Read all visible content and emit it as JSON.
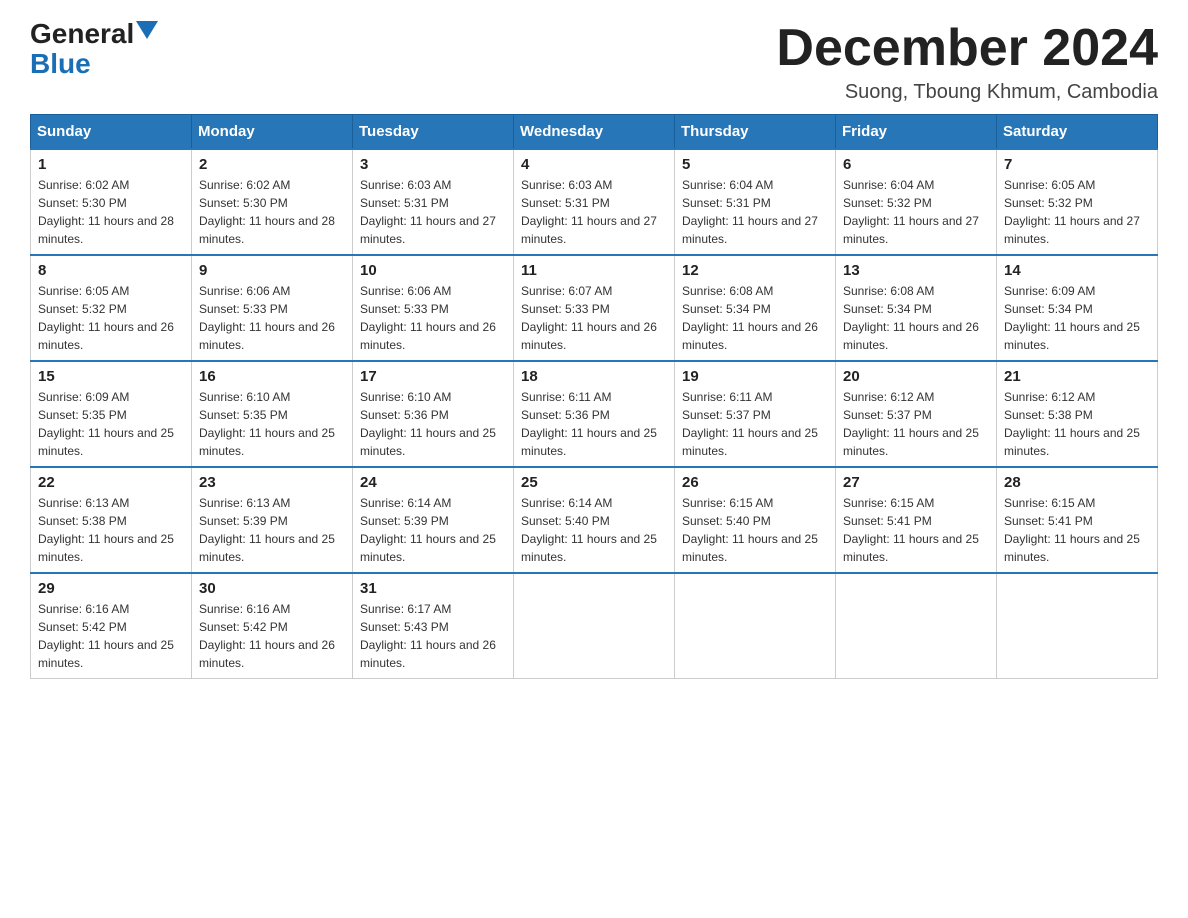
{
  "header": {
    "logo_general": "General",
    "logo_blue": "Blue",
    "month_year": "December 2024",
    "location": "Suong, Tboung Khmum, Cambodia"
  },
  "weekdays": [
    "Sunday",
    "Monday",
    "Tuesday",
    "Wednesday",
    "Thursday",
    "Friday",
    "Saturday"
  ],
  "weeks": [
    [
      {
        "day": "1",
        "sunrise": "6:02 AM",
        "sunset": "5:30 PM",
        "daylight": "11 hours and 28 minutes."
      },
      {
        "day": "2",
        "sunrise": "6:02 AM",
        "sunset": "5:30 PM",
        "daylight": "11 hours and 28 minutes."
      },
      {
        "day": "3",
        "sunrise": "6:03 AM",
        "sunset": "5:31 PM",
        "daylight": "11 hours and 27 minutes."
      },
      {
        "day": "4",
        "sunrise": "6:03 AM",
        "sunset": "5:31 PM",
        "daylight": "11 hours and 27 minutes."
      },
      {
        "day": "5",
        "sunrise": "6:04 AM",
        "sunset": "5:31 PM",
        "daylight": "11 hours and 27 minutes."
      },
      {
        "day": "6",
        "sunrise": "6:04 AM",
        "sunset": "5:32 PM",
        "daylight": "11 hours and 27 minutes."
      },
      {
        "day": "7",
        "sunrise": "6:05 AM",
        "sunset": "5:32 PM",
        "daylight": "11 hours and 27 minutes."
      }
    ],
    [
      {
        "day": "8",
        "sunrise": "6:05 AM",
        "sunset": "5:32 PM",
        "daylight": "11 hours and 26 minutes."
      },
      {
        "day": "9",
        "sunrise": "6:06 AM",
        "sunset": "5:33 PM",
        "daylight": "11 hours and 26 minutes."
      },
      {
        "day": "10",
        "sunrise": "6:06 AM",
        "sunset": "5:33 PM",
        "daylight": "11 hours and 26 minutes."
      },
      {
        "day": "11",
        "sunrise": "6:07 AM",
        "sunset": "5:33 PM",
        "daylight": "11 hours and 26 minutes."
      },
      {
        "day": "12",
        "sunrise": "6:08 AM",
        "sunset": "5:34 PM",
        "daylight": "11 hours and 26 minutes."
      },
      {
        "day": "13",
        "sunrise": "6:08 AM",
        "sunset": "5:34 PM",
        "daylight": "11 hours and 26 minutes."
      },
      {
        "day": "14",
        "sunrise": "6:09 AM",
        "sunset": "5:34 PM",
        "daylight": "11 hours and 25 minutes."
      }
    ],
    [
      {
        "day": "15",
        "sunrise": "6:09 AM",
        "sunset": "5:35 PM",
        "daylight": "11 hours and 25 minutes."
      },
      {
        "day": "16",
        "sunrise": "6:10 AM",
        "sunset": "5:35 PM",
        "daylight": "11 hours and 25 minutes."
      },
      {
        "day": "17",
        "sunrise": "6:10 AM",
        "sunset": "5:36 PM",
        "daylight": "11 hours and 25 minutes."
      },
      {
        "day": "18",
        "sunrise": "6:11 AM",
        "sunset": "5:36 PM",
        "daylight": "11 hours and 25 minutes."
      },
      {
        "day": "19",
        "sunrise": "6:11 AM",
        "sunset": "5:37 PM",
        "daylight": "11 hours and 25 minutes."
      },
      {
        "day": "20",
        "sunrise": "6:12 AM",
        "sunset": "5:37 PM",
        "daylight": "11 hours and 25 minutes."
      },
      {
        "day": "21",
        "sunrise": "6:12 AM",
        "sunset": "5:38 PM",
        "daylight": "11 hours and 25 minutes."
      }
    ],
    [
      {
        "day": "22",
        "sunrise": "6:13 AM",
        "sunset": "5:38 PM",
        "daylight": "11 hours and 25 minutes."
      },
      {
        "day": "23",
        "sunrise": "6:13 AM",
        "sunset": "5:39 PM",
        "daylight": "11 hours and 25 minutes."
      },
      {
        "day": "24",
        "sunrise": "6:14 AM",
        "sunset": "5:39 PM",
        "daylight": "11 hours and 25 minutes."
      },
      {
        "day": "25",
        "sunrise": "6:14 AM",
        "sunset": "5:40 PM",
        "daylight": "11 hours and 25 minutes."
      },
      {
        "day": "26",
        "sunrise": "6:15 AM",
        "sunset": "5:40 PM",
        "daylight": "11 hours and 25 minutes."
      },
      {
        "day": "27",
        "sunrise": "6:15 AM",
        "sunset": "5:41 PM",
        "daylight": "11 hours and 25 minutes."
      },
      {
        "day": "28",
        "sunrise": "6:15 AM",
        "sunset": "5:41 PM",
        "daylight": "11 hours and 25 minutes."
      }
    ],
    [
      {
        "day": "29",
        "sunrise": "6:16 AM",
        "sunset": "5:42 PM",
        "daylight": "11 hours and 25 minutes."
      },
      {
        "day": "30",
        "sunrise": "6:16 AM",
        "sunset": "5:42 PM",
        "daylight": "11 hours and 26 minutes."
      },
      {
        "day": "31",
        "sunrise": "6:17 AM",
        "sunset": "5:43 PM",
        "daylight": "11 hours and 26 minutes."
      },
      null,
      null,
      null,
      null
    ]
  ]
}
